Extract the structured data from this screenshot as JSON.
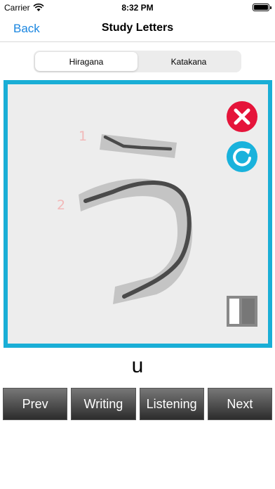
{
  "status": {
    "carrier": "Carrier",
    "time": "8:32 PM"
  },
  "nav": {
    "back_label": "Back",
    "title": "Study Letters"
  },
  "segments": [
    {
      "label": "Hiragana",
      "selected": true
    },
    {
      "label": "Katakana",
      "selected": false
    }
  ],
  "canvas": {
    "stroke_numbers": [
      "1",
      "2"
    ],
    "guide_color": "#c4c4c4",
    "stroke_color": "#4a4a4a",
    "border_color": "#1aaed6"
  },
  "icons": {
    "clear": "close-icon",
    "reset": "reload-icon",
    "toggle": "half-square-icon"
  },
  "romaji": "u",
  "buttons": {
    "prev": "Prev",
    "writing": "Writing",
    "listening": "Listening",
    "next": "Next"
  }
}
